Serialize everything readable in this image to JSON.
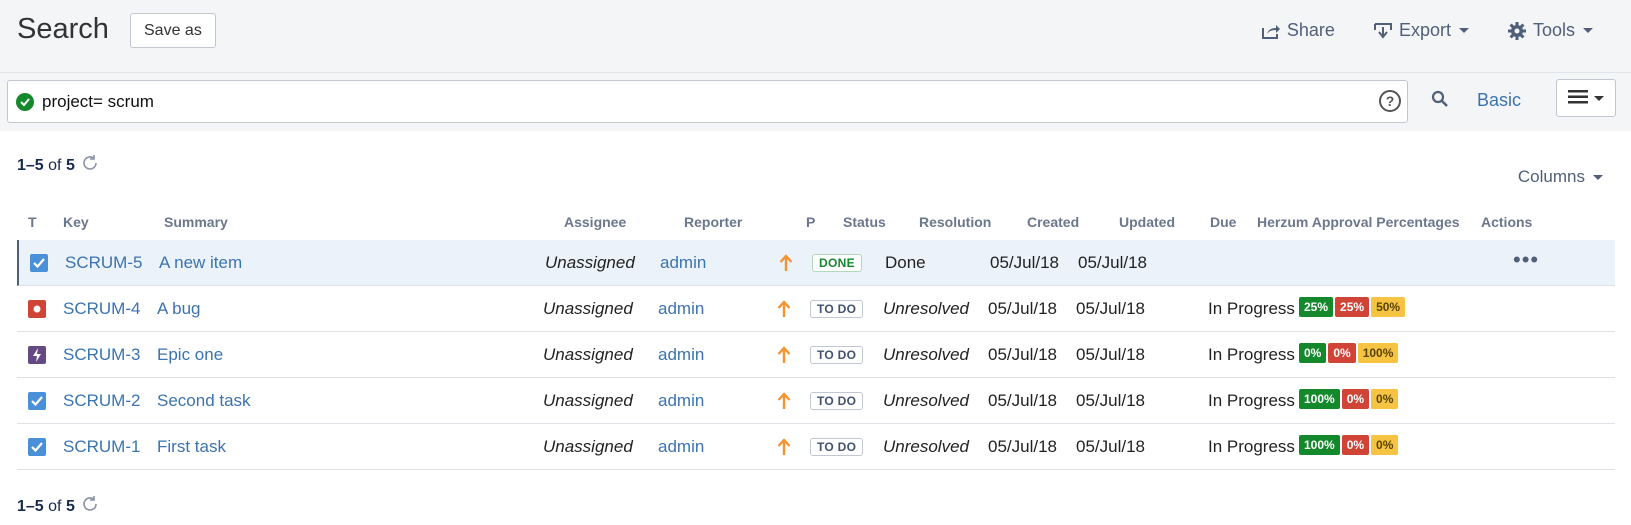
{
  "header": {
    "title": "Search",
    "save_as": "Save as",
    "share": "Share",
    "export": "Export",
    "tools": "Tools"
  },
  "search": {
    "query": "project= scrum",
    "help": "?",
    "basic_label": "Basic"
  },
  "results": {
    "range": "1–5",
    "of": "of",
    "total": "5",
    "columns_label": "Columns"
  },
  "table": {
    "headers": {
      "t": "T",
      "key": "Key",
      "summary": "Summary",
      "assignee": "Assignee",
      "reporter": "Reporter",
      "p": "P",
      "status": "Status",
      "resolution": "Resolution",
      "created": "Created",
      "updated": "Updated",
      "due": "Due",
      "herzum": "Herzum Approval Percentages",
      "actions": "Actions"
    },
    "rows": [
      {
        "type": "task-icon",
        "key": "SCRUM-5",
        "summary": "A new item",
        "assignee": "Unassigned",
        "reporter": "admin",
        "priority": "major-priority-icon",
        "status": "DONE",
        "resolution": "Done",
        "created": "05/Jul/18",
        "updated": "05/Jul/18",
        "herzum_status": "",
        "pcts": [],
        "actions": "•••"
      },
      {
        "type": "bug-icon",
        "key": "SCRUM-4",
        "summary": "A bug",
        "assignee": "Unassigned",
        "reporter": "admin",
        "priority": "major-priority-icon",
        "status": "TO DO",
        "resolution": "Unresolved",
        "created": "05/Jul/18",
        "updated": "05/Jul/18",
        "herzum_status": "In Progress",
        "pcts": [
          "25%",
          "25%",
          "50%"
        ]
      },
      {
        "type": "epic-icon",
        "key": "SCRUM-3",
        "summary": "Epic one",
        "assignee": "Unassigned",
        "reporter": "admin",
        "priority": "major-priority-icon",
        "status": "TO DO",
        "resolution": "Unresolved",
        "created": "05/Jul/18",
        "updated": "05/Jul/18",
        "herzum_status": "In Progress",
        "pcts": [
          "0%",
          "0%",
          "100%"
        ]
      },
      {
        "type": "task-icon",
        "key": "SCRUM-2",
        "summary": "Second task",
        "assignee": "Unassigned",
        "reporter": "admin",
        "priority": "major-priority-icon",
        "status": "TO DO",
        "resolution": "Unresolved",
        "created": "05/Jul/18",
        "updated": "05/Jul/18",
        "herzum_status": "In Progress",
        "pcts": [
          "100%",
          "0%",
          "0%"
        ]
      },
      {
        "type": "task-icon",
        "key": "SCRUM-1",
        "summary": "First task",
        "assignee": "Unassigned",
        "reporter": "admin",
        "priority": "major-priority-icon",
        "status": "TO DO",
        "resolution": "Unresolved",
        "created": "05/Jul/18",
        "updated": "05/Jul/18",
        "herzum_status": "In Progress",
        "pcts": [
          "100%",
          "0%",
          "0%"
        ]
      }
    ]
  },
  "colors": {
    "link": "#3b73af",
    "task": "#4a6785",
    "bug": "#d04437",
    "epic": "#654982",
    "priority": "#f79232",
    "pct_green": "#14892c",
    "pct_red": "#d04437",
    "pct_yellow": "#f6c342"
  }
}
